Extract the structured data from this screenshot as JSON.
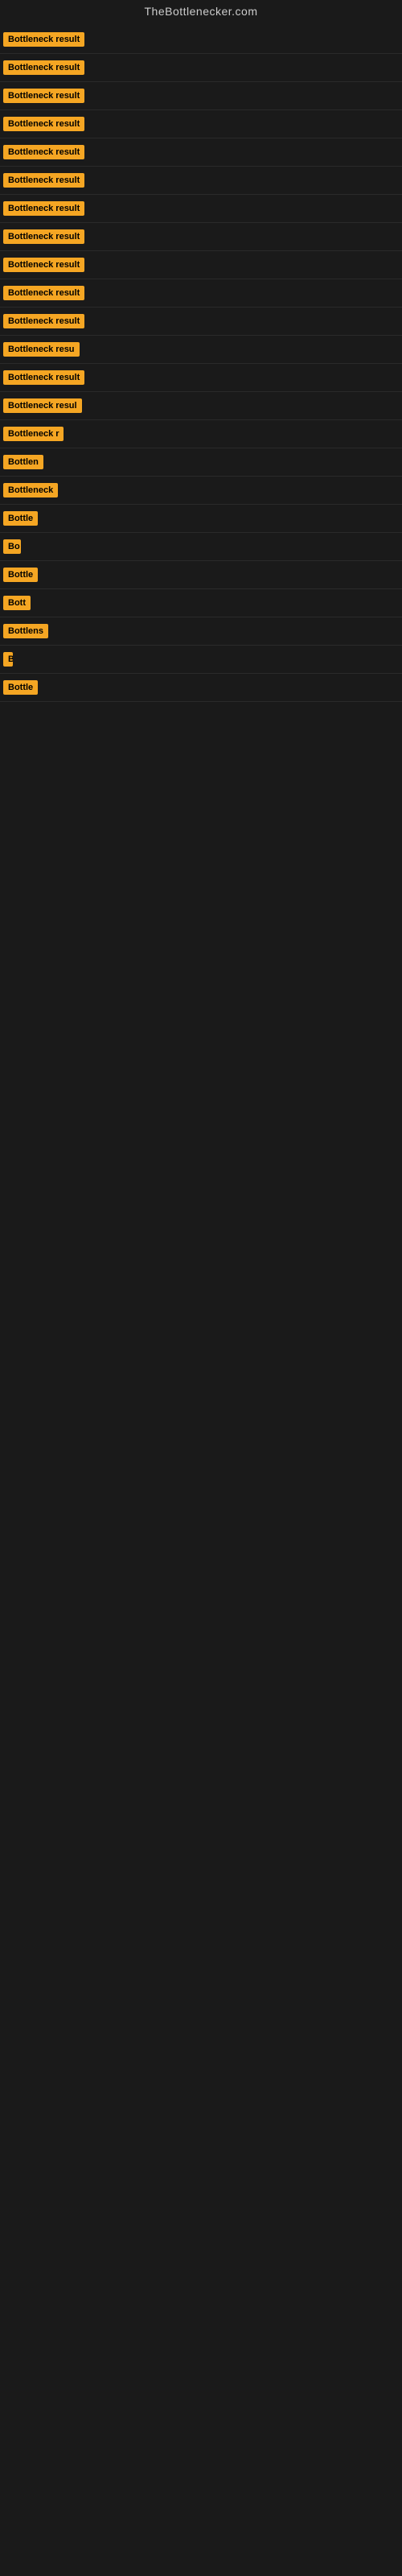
{
  "site": {
    "title": "TheBottlenecker.com"
  },
  "rows": [
    {
      "id": 1,
      "label": "Bottleneck result",
      "width": 120
    },
    {
      "id": 2,
      "label": "Bottleneck result",
      "width": 120
    },
    {
      "id": 3,
      "label": "Bottleneck result",
      "width": 120
    },
    {
      "id": 4,
      "label": "Bottleneck result",
      "width": 120
    },
    {
      "id": 5,
      "label": "Bottleneck result",
      "width": 120
    },
    {
      "id": 6,
      "label": "Bottleneck result",
      "width": 120
    },
    {
      "id": 7,
      "label": "Bottleneck result",
      "width": 120
    },
    {
      "id": 8,
      "label": "Bottleneck result",
      "width": 120
    },
    {
      "id": 9,
      "label": "Bottleneck result",
      "width": 120
    },
    {
      "id": 10,
      "label": "Bottleneck result",
      "width": 120
    },
    {
      "id": 11,
      "label": "Bottleneck result",
      "width": 120
    },
    {
      "id": 12,
      "label": "Bottleneck resu",
      "width": 105
    },
    {
      "id": 13,
      "label": "Bottleneck result",
      "width": 120
    },
    {
      "id": 14,
      "label": "Bottleneck resul",
      "width": 110
    },
    {
      "id": 15,
      "label": "Bottleneck r",
      "width": 75
    },
    {
      "id": 16,
      "label": "Bottlen",
      "width": 55
    },
    {
      "id": 17,
      "label": "Bottleneck",
      "width": 68
    },
    {
      "id": 18,
      "label": "Bottle",
      "width": 46
    },
    {
      "id": 19,
      "label": "Bo",
      "width": 22
    },
    {
      "id": 20,
      "label": "Bottle",
      "width": 46
    },
    {
      "id": 21,
      "label": "Bott",
      "width": 34
    },
    {
      "id": 22,
      "label": "Bottlens",
      "width": 56
    },
    {
      "id": 23,
      "label": "B",
      "width": 12
    },
    {
      "id": 24,
      "label": "Bottle",
      "width": 46
    }
  ]
}
